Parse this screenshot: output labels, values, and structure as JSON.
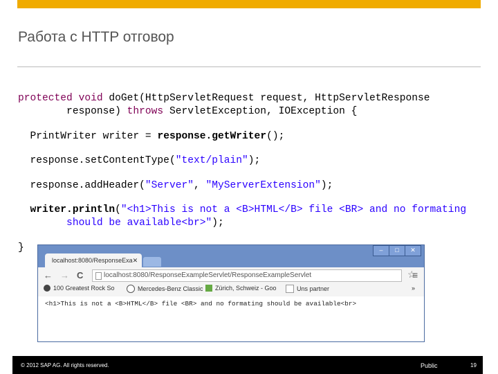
{
  "slide": {
    "title": "Работа с HTTP отговор",
    "accent_color": "#f0ab00"
  },
  "code": {
    "line1": {
      "kw1": "protected",
      "kw2": "void",
      "rest": " doGet(HttpServletRequest request, HttpServletResponse"
    },
    "line2": {
      "pre": "        response) ",
      "kw": "throws",
      "rest": " ServletException, IOException {"
    },
    "line3": {
      "pre": "  PrintWriter writer = ",
      "bold": "response.getWriter",
      "post": "();"
    },
    "line4": {
      "pre": "  response.setContentType(",
      "str": "\"text/plain\"",
      "post": ");"
    },
    "line5": {
      "pre": "  response.addHeader(",
      "str1": "\"Server\"",
      "mid": ", ",
      "str2": "\"MyServerExtension\"",
      "post": ");"
    },
    "line6": {
      "bold": "  writer.println",
      "pre": "(",
      "str": "\"<h1>This is not a <B>HTML</B> file <BR> and no formating"
    },
    "line7": {
      "str": "        should be available<br>\"",
      "post": ");"
    },
    "line8": "}",
    "keyword_color": "#7f0055",
    "string_color": "#2a00ff"
  },
  "browser": {
    "tab_title": "localhost:8080/ResponseExa",
    "url": "localhost:8080/ResponseExampleServlet/ResponseExampleServlet",
    "bookmarks": [
      "100 Greatest Rock So",
      "Mercedes-Benz Classic",
      "Zürich, Schweiz - Goo",
      "Uns partner"
    ],
    "more": "»",
    "page_text": "<h1>This is not a <B>HTML</B> file <BR> and no formating should be available<br>"
  },
  "footer": {
    "copyright": "© 2012 SAP AG. All rights reserved.",
    "classification": "Public",
    "page_number": "19"
  }
}
